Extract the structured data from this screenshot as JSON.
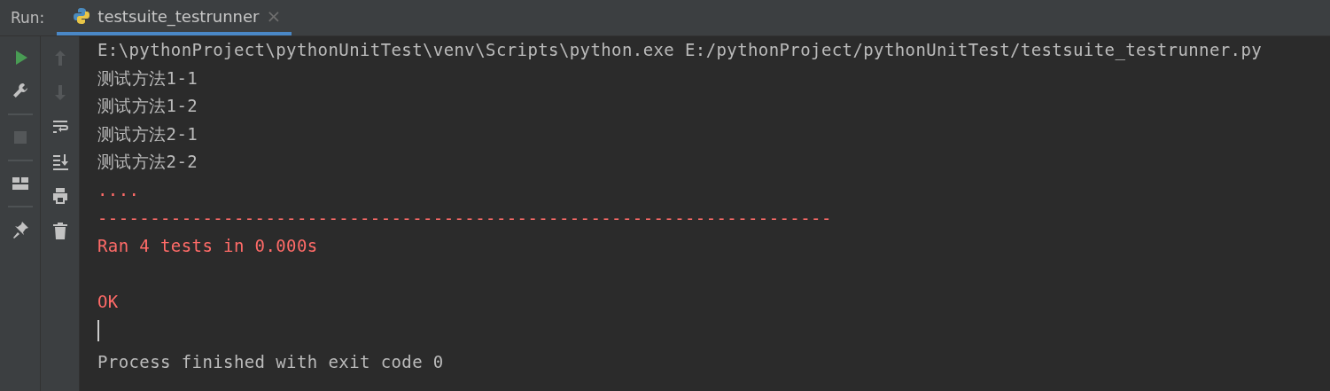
{
  "panel": {
    "title": "Run:"
  },
  "tabs": [
    {
      "label": "testsuite_testrunner",
      "selected": true,
      "close": "×"
    }
  ],
  "toolbar_left": [
    {
      "kind": "run",
      "disabled": false
    },
    {
      "kind": "wrench",
      "disabled": false
    },
    {
      "kind": "separator"
    },
    {
      "kind": "stop",
      "disabled": true
    },
    {
      "kind": "separator"
    },
    {
      "kind": "layout",
      "disabled": false
    },
    {
      "kind": "separator"
    },
    {
      "kind": "pin",
      "disabled": false
    }
  ],
  "toolbar_right": [
    {
      "kind": "up",
      "disabled": true
    },
    {
      "kind": "down",
      "disabled": true
    },
    {
      "kind": "wrap",
      "disabled": false
    },
    {
      "kind": "scroll-end",
      "disabled": false
    },
    {
      "kind": "print",
      "disabled": false
    },
    {
      "kind": "trash",
      "disabled": false
    }
  ],
  "console": [
    {
      "kind": "normal",
      "text": "E:\\pythonProject\\pythonUnitTest\\venv\\Scripts\\python.exe E:/pythonProject/pythonUnitTest/testsuite_testrunner.py"
    },
    {
      "kind": "normal",
      "text": "测试方法1-1"
    },
    {
      "kind": "normal",
      "text": "测试方法1-2"
    },
    {
      "kind": "normal",
      "text": "测试方法2-1"
    },
    {
      "kind": "normal",
      "text": "测试方法2-2"
    },
    {
      "kind": "error",
      "text": "...."
    },
    {
      "kind": "error",
      "text": "----------------------------------------------------------------------"
    },
    {
      "kind": "error",
      "text": "Ran 4 tests in 0.000s"
    },
    {
      "kind": "blank"
    },
    {
      "kind": "error",
      "text": "OK"
    },
    {
      "kind": "cursor"
    },
    {
      "kind": "normal",
      "text": "Process finished with exit code 0"
    }
  ]
}
